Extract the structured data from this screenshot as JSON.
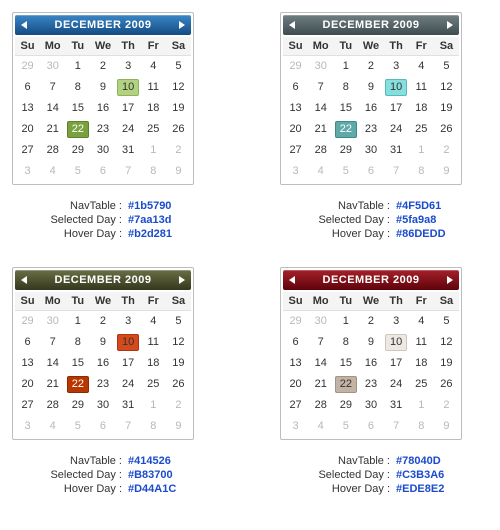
{
  "header_title": "DECEMBER 2009",
  "weekdays": [
    "Su",
    "Mo",
    "Tu",
    "We",
    "Th",
    "Fr",
    "Sa"
  ],
  "grid": [
    [
      29,
      30,
      1,
      2,
      3,
      4,
      5
    ],
    [
      6,
      7,
      8,
      9,
      10,
      11,
      12
    ],
    [
      13,
      14,
      15,
      16,
      17,
      18,
      19
    ],
    [
      20,
      21,
      22,
      23,
      24,
      25,
      26
    ],
    [
      27,
      28,
      29,
      30,
      31,
      1,
      2
    ],
    [
      3,
      4,
      5,
      6,
      7,
      8,
      9
    ]
  ],
  "prev_month_cells": 2,
  "next_month_cells": 9,
  "hover_day": 10,
  "selected_day": 22,
  "legend_labels": {
    "nav": "NavTable :",
    "sel": "Selected Day :",
    "hov": "Hover Day :"
  },
  "variants": [
    {
      "navtable": "#1b5790",
      "navgrad": "linear-gradient(#3b86c6,#134a82)",
      "selected": "#7aa13d",
      "selected_border": "#5e8228",
      "hover": "#b2d281",
      "hover_border": "#8fb35c",
      "nav_hex": "#1b5790",
      "sel_hex": "#7aa13d",
      "hov_hex": "#b2d281"
    },
    {
      "navtable": "#4F5D61",
      "navgrad": "linear-gradient(#6f7e82,#3e4c50)",
      "selected": "#5fa9a8",
      "selected_border": "#3e8a89",
      "hover": "#86DEDD",
      "hover_border": "#55bcbb",
      "nav_hex": "#4F5D61",
      "sel_hex": "#5fa9a8",
      "hov_hex": "#86DEDD"
    },
    {
      "navtable": "#414526",
      "navgrad": "linear-gradient(#6a6f45,#33371d)",
      "selected": "#B83700",
      "selected_border": "#8f2a00",
      "hover": "#D44A1C",
      "hover_border": "#aa3510",
      "nav_hex": "#414526",
      "sel_hex": "#B83700",
      "hov_hex": "#D44A1C"
    },
    {
      "navtable": "#78040D",
      "navgrad": "linear-gradient(#a5202a,#5e030a)",
      "selected": "#C3B3A6",
      "selected_border": "#a4937f",
      "hover": "#EDE8E2",
      "hover_border": "#cfc7bb",
      "nav_hex": "#78040D",
      "sel_hex": "#C3B3A6",
      "hov_hex": "#EDE8E2"
    }
  ]
}
